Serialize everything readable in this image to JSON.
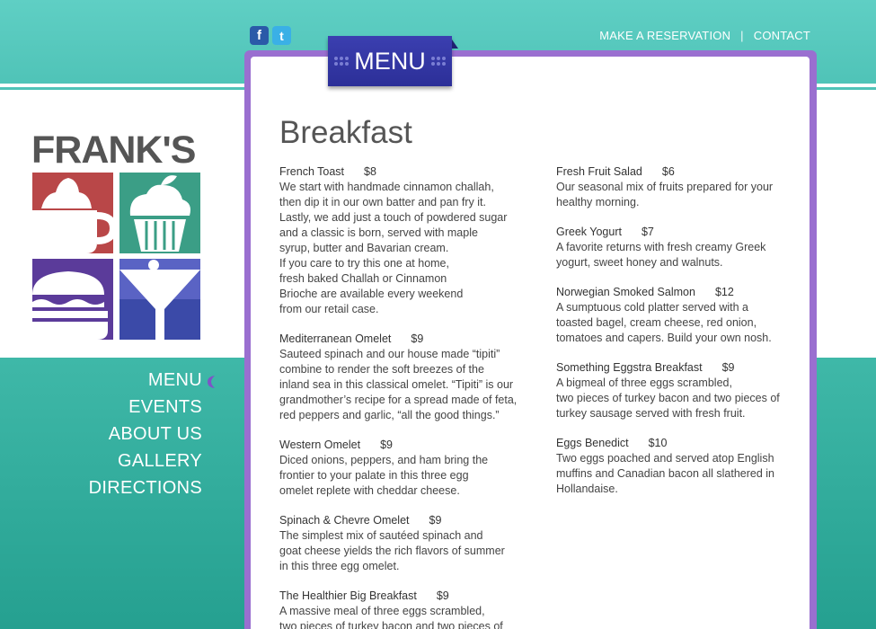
{
  "social": {
    "facebook_glyph": "f",
    "twitter_glyph": "t"
  },
  "topnav": {
    "reservation": "MAKE A RESERVATION",
    "separator": "|",
    "contact": "CONTACT"
  },
  "ribbon": {
    "label": "MENU"
  },
  "logo": {
    "text": "FRANK'S"
  },
  "sidenav": {
    "items": [
      "MENU",
      "EVENTS",
      "ABOUT US",
      "GALLERY",
      "DIRECTIONS"
    ]
  },
  "page": {
    "heading": "Breakfast"
  },
  "menu": {
    "left": [
      {
        "name": "French Toast",
        "price": "$8",
        "desc": "We start with handmade cinnamon challah,\nthen dip it in our own batter and pan fry it.\nLastly, we add just a touch of powdered sugar\nand a classic is born, served with maple\nsyrup, butter and Bavarian cream.\nIf you care to try this one at home,\nfresh baked Challah or Cinnamon\nBrioche are available every weekend\nfrom our retail case."
      },
      {
        "name": "Mediterranean Omelet",
        "price": "$9",
        "desc": "Sauteed spinach and our house made “tipiti”\ncombine to render the soft breezes of the\ninland sea in this classical omelet.  “Tipiti” is our\ngrandmother’s recipe for a spread made of feta,\nred peppers and garlic, “all the good things.”"
      },
      {
        "name": "Western Omelet",
        "price": "$9",
        "desc": "Diced onions, peppers, and ham bring the\nfrontier to your palate in this three egg\nomelet replete with cheddar cheese."
      },
      {
        "name": "Spinach & Chevre Omelet",
        "price": "$9",
        "desc": "The simplest mix of sautéed spinach and\ngoat cheese yields the rich flavors of summer\nin this three egg omelet."
      },
      {
        "name": "The Healthier Big Breakfast",
        "price": "$9",
        "desc": "A massive meal of three eggs scrambled,\ntwo pieces of turkey bacon and two pieces of"
      }
    ],
    "right": [
      {
        "name": "Fresh Fruit Salad",
        "price": "$6",
        "desc": "Our seasonal mix of fruits prepared for your\nhealthy morning."
      },
      {
        "name": "Greek Yogurt",
        "price": "$7",
        "desc": "A favorite returns with fresh creamy Greek\nyogurt, sweet honey and walnuts."
      },
      {
        "name": "Norwegian Smoked Salmon",
        "price": "$12",
        "desc": "A sumptuous cold platter served with a\ntoasted bagel, cream cheese, red onion,\ntomatoes and capers.  Build your own nosh."
      },
      {
        "name": "Something Eggstra Breakfast",
        "price": "$9",
        "desc": "A bigmeal of three eggs scrambled,\ntwo pieces of turkey bacon and two pieces of\nturkey sausage served with fresh fruit."
      },
      {
        "name": "Eggs Benedict",
        "price": "$10",
        "desc": "Two eggs poached and served atop English\nmuffins and Canadian bacon all slathered in\nHollandaise."
      }
    ]
  },
  "colors": {
    "teal_top": "#5fcfc4",
    "teal_bottom": "#25a090",
    "purple_border": "#9a6fd0",
    "ribbon_blue": "#2c2f98",
    "heading_gray": "#555555"
  }
}
